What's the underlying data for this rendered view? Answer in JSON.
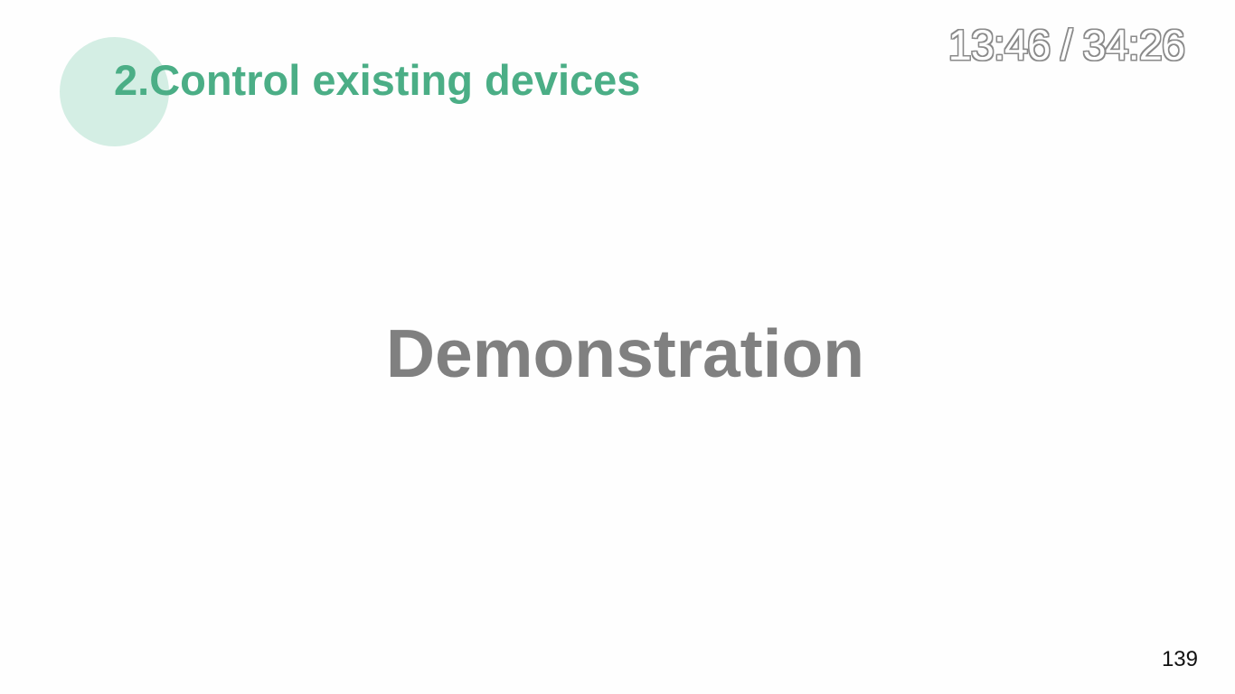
{
  "slide": {
    "title": "2.Control existing devices",
    "main_text": "Demonstration",
    "page_number": "139"
  },
  "player": {
    "timecode": "13:46 / 34:26"
  },
  "colors": {
    "title_green": "#4bae86",
    "circle_light_green": "#d4eee4",
    "body_gray": "#808080",
    "background": "#fefefe"
  }
}
